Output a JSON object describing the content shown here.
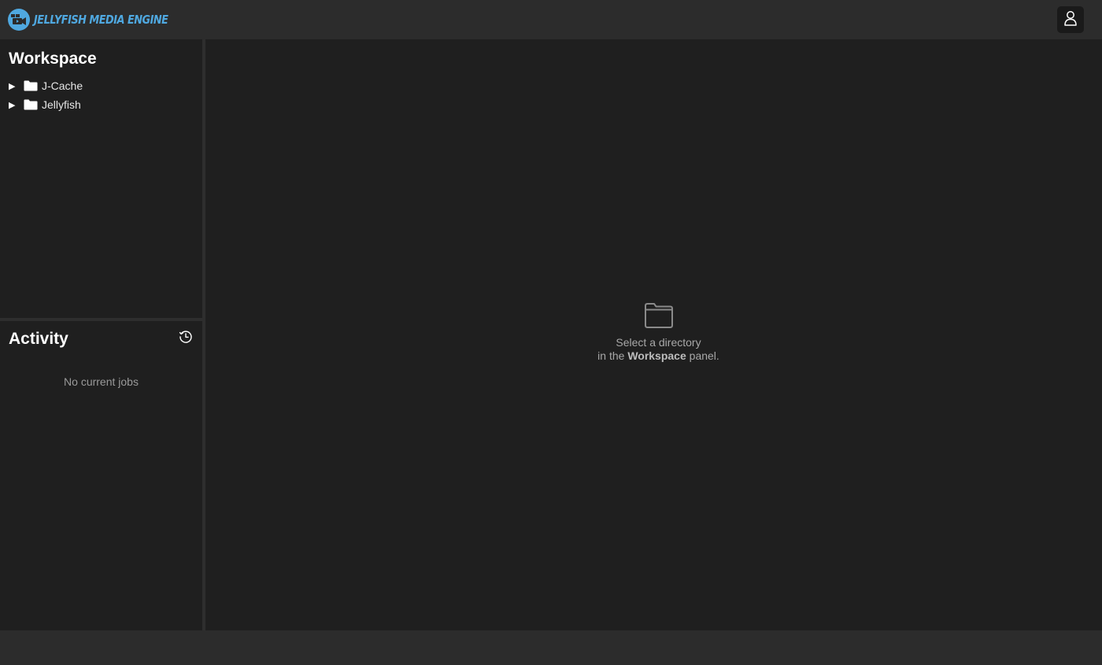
{
  "app": {
    "name": "JELLYFISH MEDIA ENGINE",
    "accent_color": "#4fa8e0",
    "logo_icon": "camera-film-icon",
    "user_icon": "user-icon"
  },
  "workspace": {
    "title": "Workspace",
    "items": [
      {
        "label": "J-Cache",
        "expand_icon": "triangle-right-icon",
        "icon": "folder-icon"
      },
      {
        "label": "Jellyfish",
        "expand_icon": "triangle-right-icon",
        "icon": "folder-icon"
      }
    ]
  },
  "activity": {
    "title": "Activity",
    "history_icon": "history-clock-icon",
    "empty_text": "No current jobs"
  },
  "main": {
    "empty_icon": "folder-outline-icon",
    "line1": "Select a directory",
    "line2_prefix": "in the ",
    "line2_bold": "Workspace",
    "line2_suffix": " panel."
  }
}
